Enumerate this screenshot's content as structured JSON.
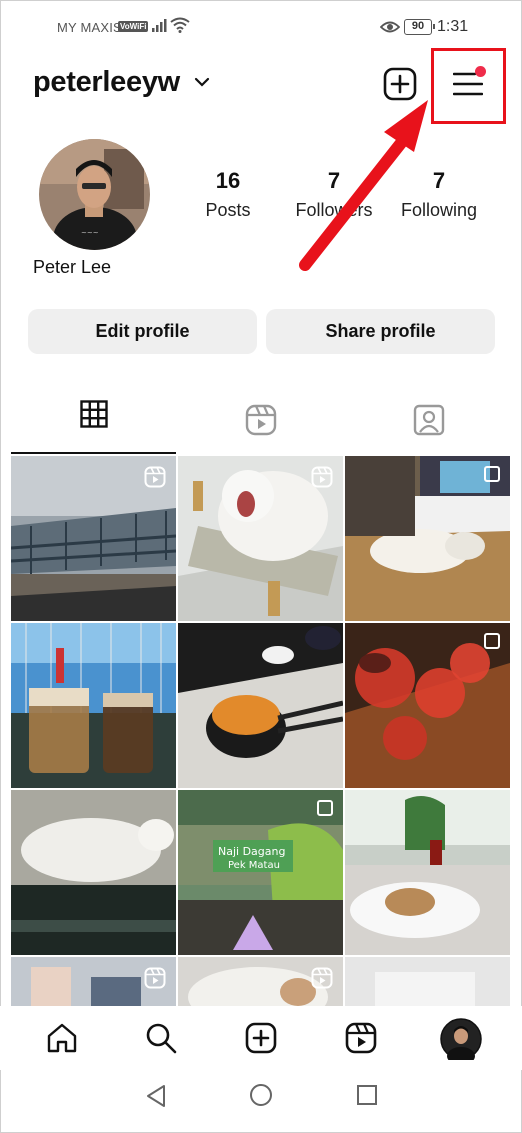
{
  "status_bar": {
    "carrier": "MY MAXIS",
    "vowifi": "VoWiFi",
    "battery": "90",
    "time": "1:31"
  },
  "header": {
    "username": "peterleeyw",
    "icons": [
      "chevron-down-icon",
      "create-plus-icon",
      "menu-hamburger-icon"
    ]
  },
  "profile": {
    "full_name": "Peter Lee",
    "stats": [
      {
        "value": "16",
        "label": "Posts"
      },
      {
        "value": "7",
        "label": "Followers"
      },
      {
        "value": "7",
        "label": "Following"
      }
    ]
  },
  "actions": {
    "edit_profile": "Edit profile",
    "share_profile": "Share profile"
  },
  "tabs": [
    "grid-icon",
    "reels-icon",
    "tagged-icon"
  ],
  "annotation": {
    "color": "#e8121b"
  },
  "bottom_nav": [
    "home-icon",
    "search-icon",
    "create-icon",
    "reels-icon",
    "profile-avatar"
  ]
}
